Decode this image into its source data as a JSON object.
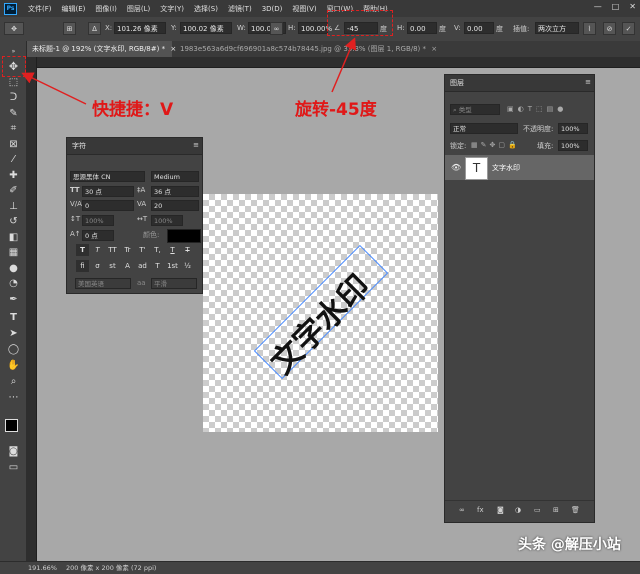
{
  "menubar": {
    "logo": "Ps",
    "items": [
      "文件(F)",
      "编辑(E)",
      "图像(I)",
      "图层(L)",
      "文字(Y)",
      "选择(S)",
      "滤镜(T)",
      "3D(D)",
      "视图(V)",
      "窗口(W)",
      "帮助(H)"
    ],
    "controls": [
      "—",
      "□",
      "✕"
    ]
  },
  "options": {
    "x_label": "X:",
    "x_value": "101.26 像素",
    "y_label": "Y:",
    "y_value": "100.02 像素",
    "w_label": "W:",
    "w_value": "100.00%",
    "h_label": "H:",
    "h_value": "100.00%",
    "angle_value": "-45",
    "angle_unit": "度",
    "hskew_label": "H:",
    "hskew_value": "0.00",
    "hskew_unit": "度",
    "vskew_label": "V:",
    "vskew_value": "0.00",
    "vskew_unit": "度",
    "interp_label": "插值:",
    "interp_value": "两次立方"
  },
  "tabs": [
    {
      "label": "未标题-1 @ 192% (文字水印, RGB/8#) *",
      "close": "×"
    },
    {
      "label": "1983e563a6d9cf696901a8c574b78445.jpg @ 33.3% (图层 1, RGB/8) *",
      "close": "×"
    }
  ],
  "annotations": {
    "shortcut": "快捷捷：V",
    "rotate": "旋转-45度"
  },
  "canvas": {
    "text": "文字水印"
  },
  "char_panel": {
    "title": "字符",
    "font_family": "思源黑体 CN",
    "font_style": "Medium",
    "size": "30 点",
    "leading": "36 点",
    "kerning_value": "0",
    "tracking_value": "20",
    "vscale": "100%",
    "hscale": "100%",
    "baseline": "0 点",
    "color_label": "颜色:",
    "type_buttons": [
      "T",
      "T",
      "TT",
      "Tr",
      "T'",
      "T,",
      "T",
      "T"
    ],
    "ot_buttons": [
      "fi",
      "σ",
      "st",
      "A",
      "ad",
      "T",
      "1st",
      "½"
    ],
    "language": "美国英语",
    "aa_label": "aa",
    "aa_value": "平滑"
  },
  "layers_panel": {
    "title": "图层",
    "filter_label": "类型",
    "blend_mode": "正常",
    "opacity_label": "不透明度:",
    "opacity_value": "100%",
    "lock_label": "锁定:",
    "fill_label": "填充:",
    "fill_value": "100%",
    "layers": [
      {
        "name": "文字水印",
        "thumb": "T",
        "visible": "eye-icon"
      }
    ],
    "footer_icons": [
      "link-icon",
      "fx-icon",
      "mask-icon",
      "adjustment-icon",
      "folder-icon",
      "new-layer-icon",
      "trash-icon"
    ]
  },
  "status": {
    "zoom": "191.66%",
    "doc_info": "200 像素 x 200 像素 (72 ppi)"
  },
  "watermark": "头条 @解压小站",
  "colors": {
    "accent": "#e02020",
    "app_bg": "#535353",
    "panel_bg": "#434343"
  }
}
